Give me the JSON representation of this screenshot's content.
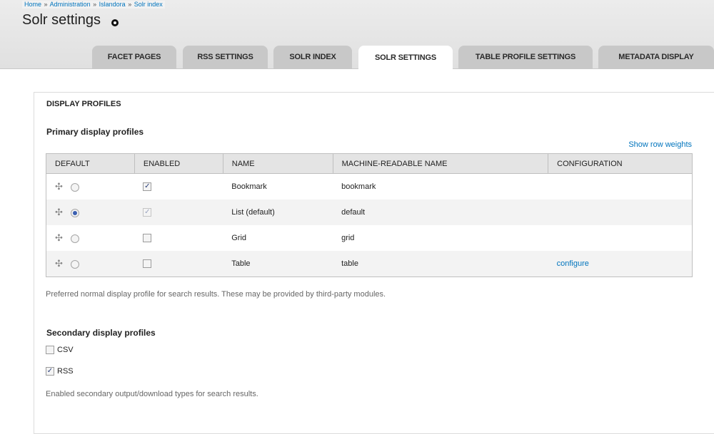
{
  "breadcrumb": [
    "Home",
    "Administration",
    "Islandora",
    "Solr index"
  ],
  "breadcrumb_sep": "»",
  "page_title": "Solr settings",
  "tabs": [
    {
      "label": "FACET PAGES",
      "active": false
    },
    {
      "label": "RSS SETTINGS",
      "active": false
    },
    {
      "label": "SOLR INDEX",
      "active": false
    },
    {
      "label": "SOLR SETTINGS",
      "active": true
    },
    {
      "label": "TABLE PROFILE SETTINGS",
      "active": false
    },
    {
      "label": "METADATA DISPLAY",
      "active": false
    }
  ],
  "fieldset_legend": "DISPLAY PROFILES",
  "primary_heading": "Primary display profiles",
  "show_row_weights": "Show row weights",
  "table": {
    "headers": [
      "DEFAULT",
      "ENABLED",
      "NAME",
      "MACHINE-READABLE NAME",
      "CONFIGURATION"
    ],
    "rows": [
      {
        "default": false,
        "enabled": true,
        "enabled_disabled": false,
        "name": "Bookmark",
        "machine": "bookmark",
        "config": ""
      },
      {
        "default": true,
        "enabled": true,
        "enabled_disabled": true,
        "name": "List (default)",
        "machine": "default",
        "config": ""
      },
      {
        "default": false,
        "enabled": false,
        "enabled_disabled": false,
        "name": "Grid",
        "machine": "grid",
        "config": ""
      },
      {
        "default": false,
        "enabled": false,
        "enabled_disabled": false,
        "name": "Table",
        "machine": "table",
        "config": "configure"
      }
    ]
  },
  "primary_description": "Preferred normal display profile for search results. These may be provided by third-party modules.",
  "secondary_heading": "Secondary display profiles",
  "secondary_options": [
    {
      "label": "CSV",
      "checked": false
    },
    {
      "label": "RSS",
      "checked": true
    }
  ],
  "secondary_description": "Enabled secondary output/download types for search results.",
  "colors": {
    "link": "#0074bd",
    "header_bg": "#e0e0e0",
    "tab_bg": "#c8c8c8"
  }
}
